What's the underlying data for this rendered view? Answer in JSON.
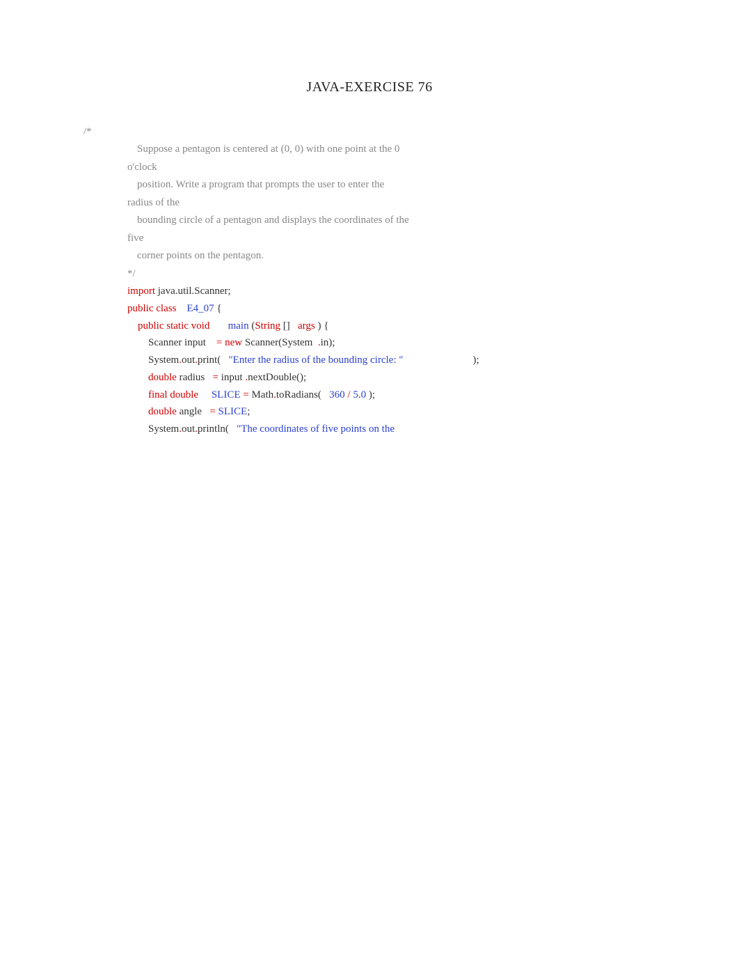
{
  "title": "JAVA-EXERCISE 76",
  "comment_open": "/*",
  "comment": {
    "l1": "Suppose a pentagon is centered at (0, 0) with one point at the 0",
    "l1b": "o'clock",
    "l2": "position. Write a program that prompts the user to enter the",
    "l2b": "radius of the",
    "l3": "bounding circle of a pentagon and displays the coordinates of the",
    "l3b": "five",
    "l4": "corner points on the pentagon.",
    "close": "*/"
  },
  "code": {
    "import_kw": "import",
    "import_pkg": " java.util.Scanner;",
    "public_class": "public class",
    "class_name": "E4_07",
    "brace_open": " {",
    "psv": "public static void",
    "main": "main",
    "lparen": " (",
    "string": "String",
    "brackets": " []",
    "args": "args",
    "rparen_brace": ") {",
    "scanner_decl_a": "Scanner input ",
    "eq_new": "= new",
    "scanner_decl_b": " Scanner(System",
    "dot_in": ".",
    "in_end": "in);",
    "sys1_a": "System",
    "dot1": ".",
    "out1": "out",
    "dot2": ".",
    "print1": "print(",
    "str1": "\"Enter the radius of the bounding circle: \"",
    "tail1": ");",
    "double_kw": "double",
    "radius": " radius ",
    "eq1": "=",
    "input_next": " input",
    "dot3": ".",
    "nextDouble": "nextDouble();",
    "final_double": "final double",
    "slice": "SLICE",
    "eq2": "=",
    "math": " Math",
    "dot4": ".",
    "toRad": "toRadians(",
    "n360": "360",
    "slash": "/",
    "n5": "5.0",
    "close_paren": ");",
    "double_kw2": "double",
    "angle": " angle ",
    "eq3": "=",
    "slice2": " SLICE",
    "semi": ";",
    "sys2_a": "System",
    "dot5": ".",
    "out2": "out",
    "dot6": ".",
    "println": "println(",
    "str2": "\"The coordinates of five points on the"
  }
}
